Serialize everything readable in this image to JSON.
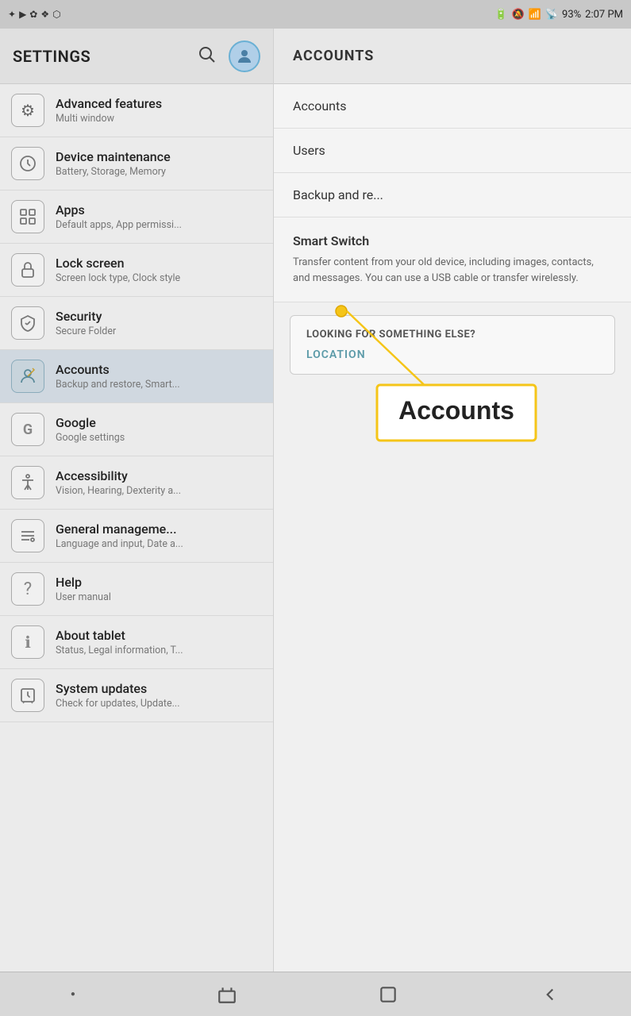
{
  "statusBar": {
    "leftIcons": [
      "✦",
      "▶",
      "✿",
      "❖",
      "⬡"
    ],
    "battery": "93%",
    "time": "2:07 PM",
    "batteryIcon": "🔋",
    "wifiIcon": "wifi",
    "signalIcon": "signal"
  },
  "sidebar": {
    "title": "SETTINGS",
    "searchLabel": "Search",
    "avatarIcon": "👤",
    "items": [
      {
        "id": "advanced-features",
        "title": "Advanced features",
        "subtitle": "Multi window",
        "icon": "⚙"
      },
      {
        "id": "device-maintenance",
        "title": "Device maintenance",
        "subtitle": "Battery, Storage, Memory",
        "icon": "🔧"
      },
      {
        "id": "apps",
        "title": "Apps",
        "subtitle": "Default apps, App permissi...",
        "icon": "⊞"
      },
      {
        "id": "lock-screen",
        "title": "Lock screen",
        "subtitle": "Screen lock type, Clock style",
        "icon": "🔒"
      },
      {
        "id": "security",
        "title": "Security",
        "subtitle": "Secure Folder",
        "icon": "🛡"
      },
      {
        "id": "accounts",
        "title": "Accounts",
        "subtitle": "Backup and restore, Smart...",
        "icon": "🔑",
        "active": true
      },
      {
        "id": "google",
        "title": "Google",
        "subtitle": "Google settings",
        "icon": "G"
      },
      {
        "id": "accessibility",
        "title": "Accessibility",
        "subtitle": "Vision, Hearing, Dexterity a...",
        "icon": "♿"
      },
      {
        "id": "general-management",
        "title": "General manageme...",
        "subtitle": "Language and input, Date a...",
        "icon": "≡"
      },
      {
        "id": "help",
        "title": "Help",
        "subtitle": "User manual",
        "icon": "?"
      },
      {
        "id": "about-tablet",
        "title": "About tablet",
        "subtitle": "Status, Legal information, T...",
        "icon": "ℹ"
      },
      {
        "id": "system-updates",
        "title": "System updates",
        "subtitle": "Check for updates, Update...",
        "icon": "🔄"
      }
    ]
  },
  "rightPanel": {
    "headerTitle": "ACCOUNTS",
    "menuItems": [
      {
        "id": "accounts",
        "label": "Accounts"
      },
      {
        "id": "users",
        "label": "Users"
      },
      {
        "id": "backup",
        "label": "Backup and re..."
      }
    ],
    "smartSwitch": {
      "title": "Smart Switch",
      "description": "Transfer content from your old device, including images, contacts, and messages. You can use a USB cable or transfer wirelessly."
    },
    "lookingForBox": {
      "title": "LOOKING FOR SOMETHING ELSE?",
      "link": "LOCATION"
    }
  },
  "annotation": {
    "calloutText": "Accounts",
    "dotLabel": "•"
  },
  "navBar": {
    "recentIcon": "recent",
    "homeIcon": "home",
    "backIcon": "back",
    "dotIcon": "•"
  }
}
